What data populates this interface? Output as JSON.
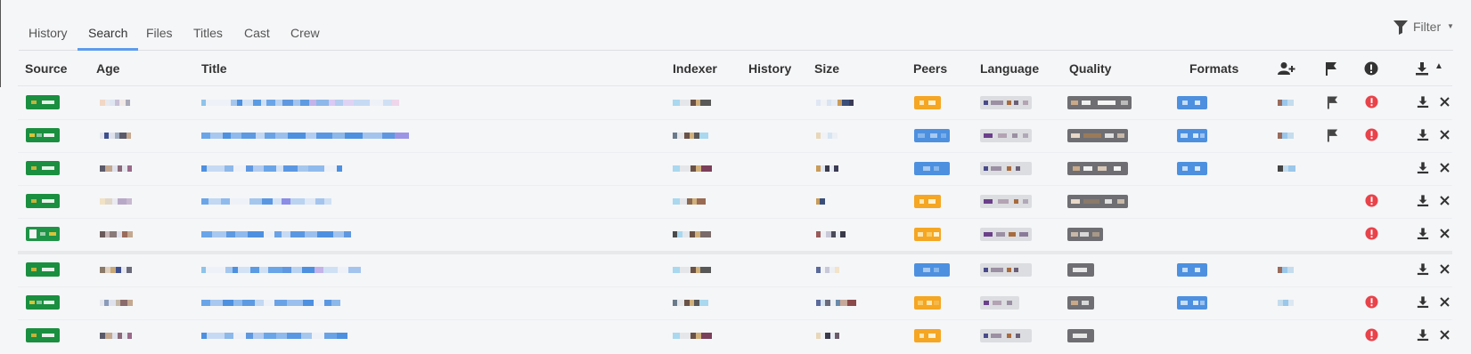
{
  "tabs": [
    {
      "label": "History",
      "active": false
    },
    {
      "label": "Search",
      "active": true
    },
    {
      "label": "Files",
      "active": false
    },
    {
      "label": "Titles",
      "active": false
    },
    {
      "label": "Cast",
      "active": false
    },
    {
      "label": "Crew",
      "active": false
    }
  ],
  "filter": {
    "label": "Filter",
    "icon": "funnel-icon"
  },
  "columns": {
    "source": "Source",
    "age": "Age",
    "title": "Title",
    "indexer": "Indexer",
    "history": "History",
    "size": "Size",
    "peers": "Peers",
    "language": "Language",
    "quality": "Quality",
    "formats": "Formats",
    "icons": [
      "add-user-icon",
      "flag-icon",
      "alert-icon",
      "download-icon",
      "sort-asc-icon"
    ]
  },
  "colors": {
    "accent": "#5d9cec",
    "source_badge": "#1a8f3f",
    "peers_good": "#4d90e0",
    "peers_low": "#f5a623",
    "quality_badge": "#6f6f73",
    "language_badge": "#dcdde0",
    "format_badge": "#4d90e0",
    "alert": "#e8424a"
  },
  "rows": [
    {
      "peers_status": "low",
      "flag": true,
      "alert": true
    },
    {
      "peers_status": "good",
      "flag": true,
      "alert": true
    },
    {
      "peers_status": "good",
      "flag": false,
      "alert": false
    },
    {
      "peers_status": "low",
      "flag": false,
      "alert": true
    },
    {
      "peers_status": "low",
      "flag": false,
      "alert": true
    },
    {
      "peers_status": "good",
      "flag": false,
      "alert": false
    },
    {
      "peers_status": "low",
      "flag": false,
      "alert": true
    },
    {
      "peers_status": "low",
      "flag": false,
      "alert": true
    }
  ],
  "row_actions": [
    "download-icon",
    "close-icon"
  ],
  "redacted_note": "Cell contents pixelated in original"
}
